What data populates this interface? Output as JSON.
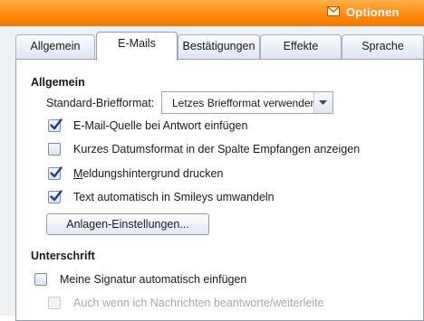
{
  "window": {
    "title": "Optionen",
    "title_icon": "envelope-icon",
    "accent_color": "#ff8a10"
  },
  "tabs": [
    {
      "label": "Allgemein",
      "active": false
    },
    {
      "label": "E-Mails",
      "active": true
    },
    {
      "label": "Bestätigungen",
      "active": false
    },
    {
      "label": "Effekte",
      "active": false
    },
    {
      "label": "Sprache",
      "active": false
    }
  ],
  "general": {
    "heading": "Allgemein",
    "letter_format_label": "Standard-Briefformat:",
    "letter_format_value": "Letzes Briefformat verwenden",
    "options": [
      {
        "label": "E-Mail-Quelle bei Antwort einfügen",
        "checked": true,
        "enabled": true
      },
      {
        "label": "Kurzes Datumsformat in der Spalte Empfangen anzeigen",
        "checked": false,
        "enabled": true
      },
      {
        "label_prefix": "",
        "label_mnemonic": "M",
        "label_rest": "eldungshintergrund drucken",
        "checked": true,
        "enabled": true
      },
      {
        "label": "Text automatisch in Smileys umwandeln",
        "checked": true,
        "enabled": true
      }
    ],
    "attachments_button": "Anlagen-Einstellungen..."
  },
  "signature": {
    "heading": "Unterschrift",
    "options": [
      {
        "label": "Meine Signatur automatisch einfügen",
        "checked": false,
        "enabled": true
      },
      {
        "label": "Auch wenn ich Nachrichten beantworte/weiterleite",
        "checked": false,
        "enabled": false
      }
    ]
  }
}
